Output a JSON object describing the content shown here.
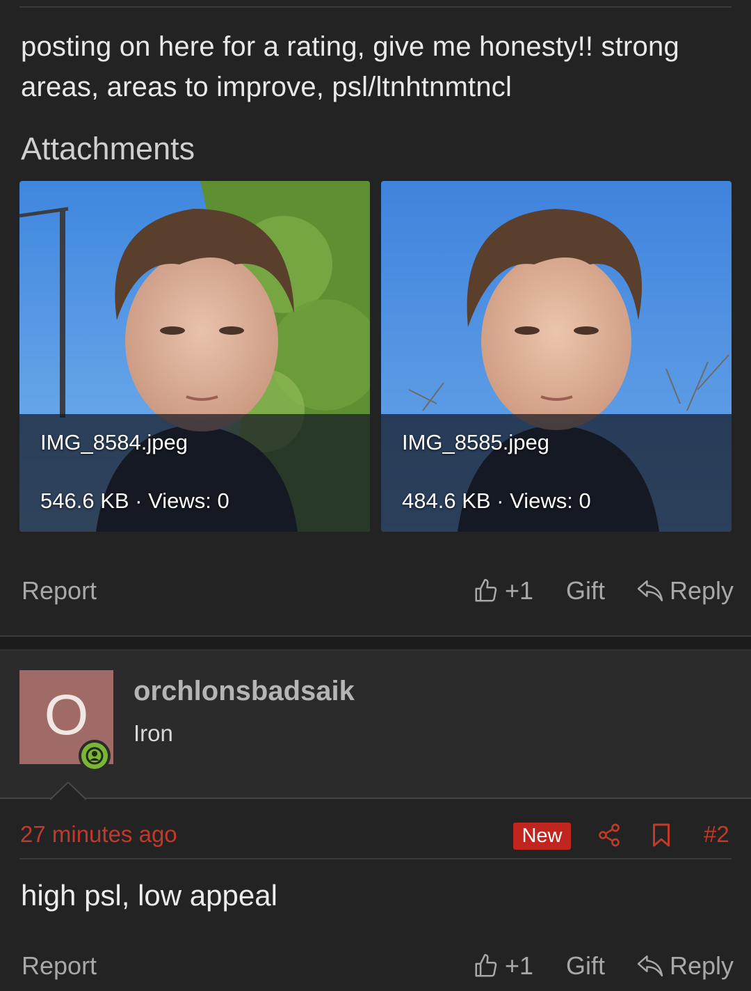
{
  "post": {
    "text": "posting on here for a rating, give me honesty!! strong areas, areas to improve, psl/ltnhtnmtncl",
    "attachments_heading": "Attachments",
    "attachments": [
      {
        "filename": "IMG_8584.jpeg",
        "meta": "546.6 KB · Views: 0"
      },
      {
        "filename": "IMG_8585.jpeg",
        "meta": "484.6 KB · Views: 0"
      }
    ],
    "actions": {
      "report": "Report",
      "like": "+1",
      "gift": "Gift",
      "reply": "Reply"
    }
  },
  "reply_post": {
    "avatar_letter": "O",
    "username": "orchlonsbadsaik",
    "rank": "Iron",
    "time_ago": "27 minutes ago",
    "badge": "New",
    "post_number": "#2",
    "text": "high psl, low appeal",
    "actions": {
      "report": "Report",
      "like": "+1",
      "gift": "Gift",
      "reply": "Reply"
    }
  },
  "colors": {
    "background": "#232323",
    "accent_red": "#c0392b",
    "avatar_bg": "#a06a66",
    "online_green": "#7ab535"
  }
}
